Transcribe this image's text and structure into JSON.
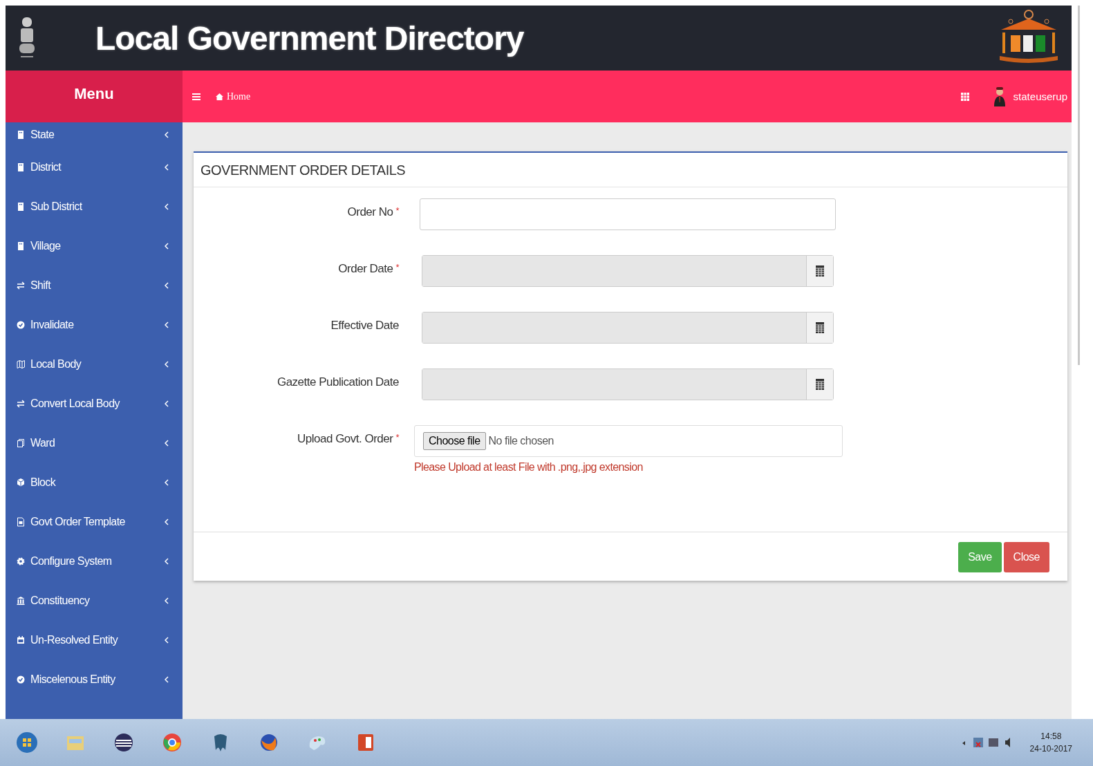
{
  "header": {
    "title": "Local Government Directory"
  },
  "navbar": {
    "menu_title": "Menu",
    "breadcrumb": "Home",
    "user": "stateuserup"
  },
  "sidebar": {
    "items": [
      {
        "label": "State"
      },
      {
        "label": "District"
      },
      {
        "label": "Sub District"
      },
      {
        "label": "Village"
      },
      {
        "label": "Shift"
      },
      {
        "label": "Invalidate"
      },
      {
        "label": "Local Body"
      },
      {
        "label": "Convert Local Body"
      },
      {
        "label": "Ward"
      },
      {
        "label": "Block"
      },
      {
        "label": "Govt Order Template"
      },
      {
        "label": "Configure System"
      },
      {
        "label": "Constituency"
      },
      {
        "label": "Un-Resolved Entity"
      },
      {
        "label": "Miscelenous Entity"
      }
    ]
  },
  "panel": {
    "title": "GOVERNMENT ORDER DETAILS",
    "fields": [
      {
        "kind": "text",
        "label": "Order No",
        "required_mark": "*"
      },
      {
        "kind": "date",
        "label": "Order Date",
        "required_mark": "*"
      },
      {
        "kind": "date",
        "label": "Effective Date"
      },
      {
        "kind": "date",
        "label": "Gazette Publication Date"
      },
      {
        "kind": "file",
        "label": "Upload Govt. Order",
        "required_mark": "*",
        "button": "Choose file",
        "value": "No file chosen",
        "error": "Please Upload at least File with .png,.jpg extension"
      }
    ],
    "buttons": [
      {
        "label": "Save",
        "kind": "success"
      },
      {
        "label": "Close",
        "kind": "danger"
      }
    ]
  },
  "taskbar": {
    "time": "14:58",
    "date": "24-10-2017"
  }
}
